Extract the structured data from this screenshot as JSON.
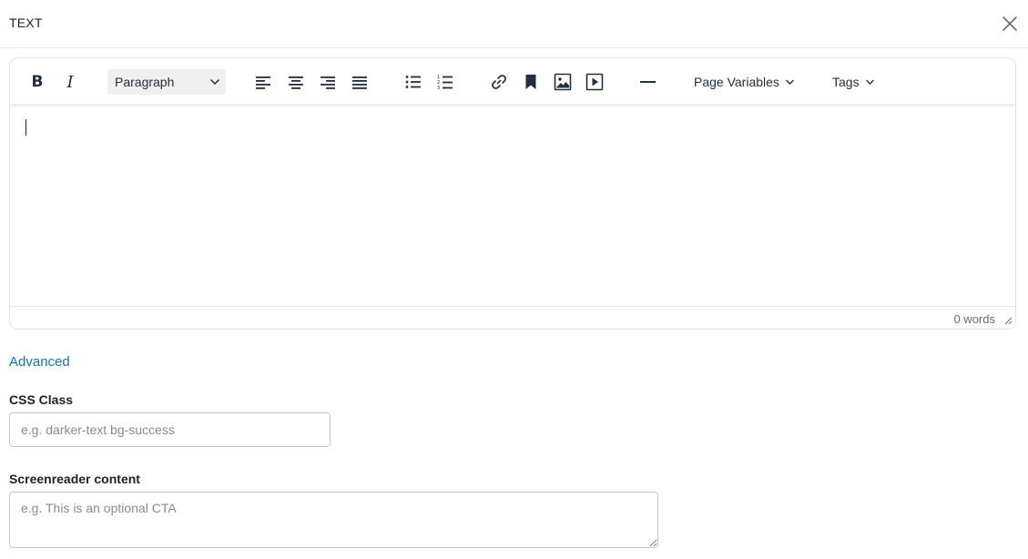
{
  "dialog": {
    "title": "TEXT",
    "close_icon": "close-icon"
  },
  "editor": {
    "toolbar": {
      "bold_label": "B",
      "italic_label": "I",
      "format_select": "Paragraph",
      "icons": [
        "align-left-icon",
        "align-center-icon",
        "align-right-icon",
        "align-justify-icon",
        "bullet-list-icon",
        "numbered-list-icon",
        "link-icon",
        "bookmark-icon",
        "image-icon",
        "media-icon",
        "horizontal-line-icon"
      ],
      "page_variables_label": "Page Variables",
      "tags_label": "Tags"
    },
    "content": "",
    "word_count": "0 words"
  },
  "advanced": {
    "link_label": "Advanced"
  },
  "fields": {
    "css_class": {
      "label": "CSS Class",
      "value": "",
      "placeholder": "e.g. darker-text bg-success"
    },
    "screenreader": {
      "label": "Screenreader content",
      "value": "",
      "placeholder": "e.g. This is an optional CTA"
    }
  }
}
